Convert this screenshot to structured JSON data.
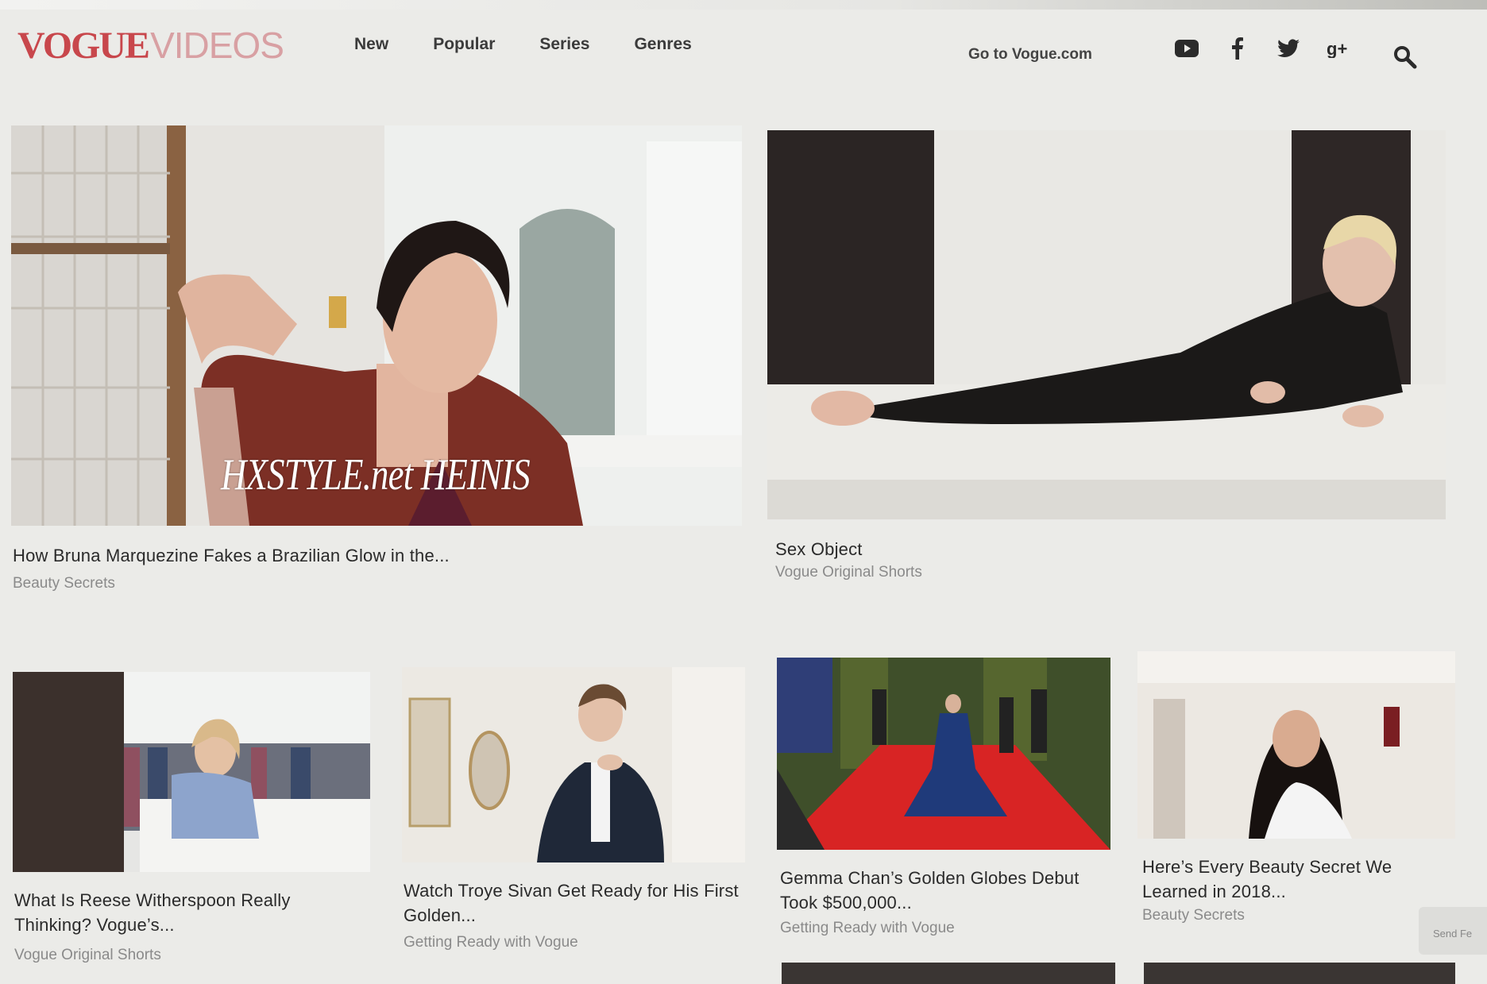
{
  "logo": {
    "part1": "VOGUE",
    "part2": "VIDEOS"
  },
  "nav": [
    "New",
    "Popular",
    "Series",
    "Genres"
  ],
  "goto_link": "Go to Vogue.com",
  "social_icons": [
    "youtube-icon",
    "facebook-icon",
    "twitter-icon",
    "google-plus-icon"
  ],
  "watermark": "HXSTYLE.net HEINIS",
  "featured": [
    {
      "title": "How Bruna Marquezine Fakes a Brazilian Glow in the...",
      "series": "Beauty Secrets"
    },
    {
      "title": "Sex Object",
      "series": "Vogue Original Shorts"
    }
  ],
  "grid": [
    {
      "title": "What Is Reese Witherspoon Really Thinking? Vogue’s...",
      "series": "Vogue Original Shorts"
    },
    {
      "title": "Watch Troye Sivan Get Ready for His First Golden...",
      "series": "Getting Ready with Vogue"
    },
    {
      "title": "Gemma Chan’s Golden Globes Debut Took $500,000...",
      "series": "Getting Ready with Vogue"
    },
    {
      "title": "Here’s Every Beauty Secret We Learned in 2018...",
      "series": "Beauty Secrets"
    }
  ],
  "feedback_label": "Send Fe",
  "colors": {
    "brand": "#c8474c",
    "brand_light": "#d8a0a3",
    "background": "#ebebe8"
  }
}
